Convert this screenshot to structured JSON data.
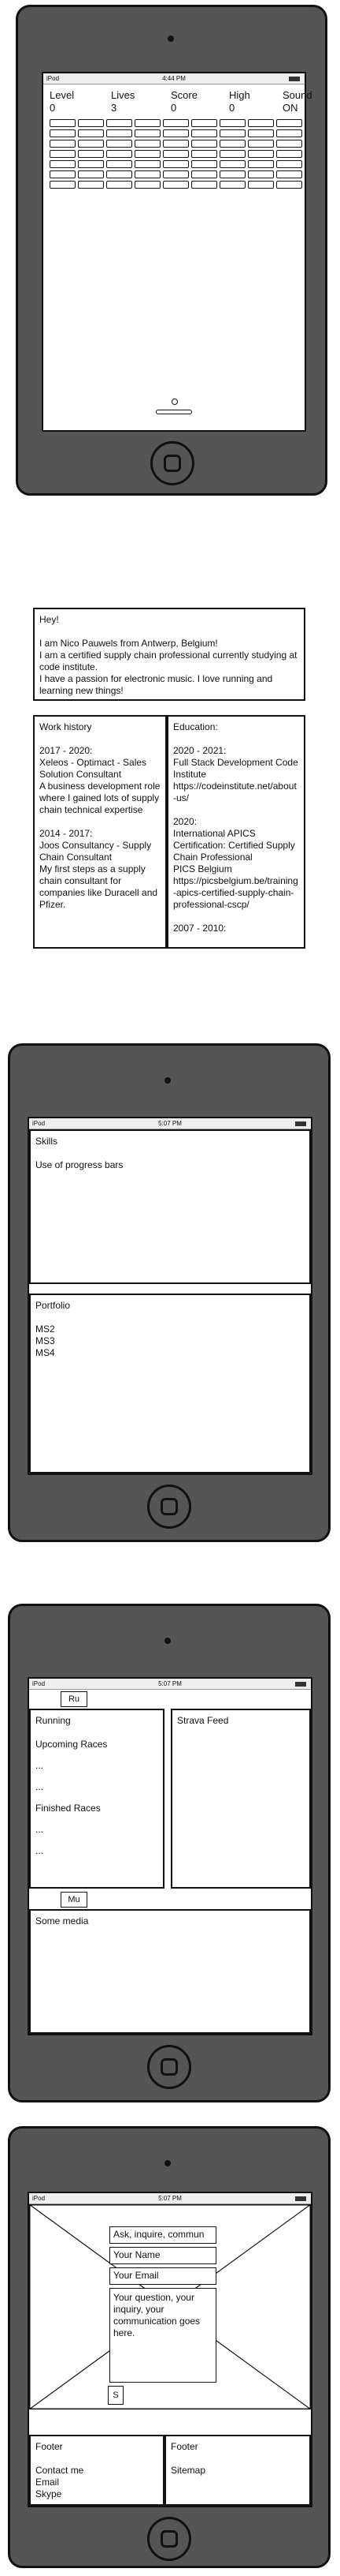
{
  "game_screen": {
    "status": {
      "carrier": "iPod",
      "time": "4:44 PM"
    },
    "stats": [
      {
        "label": "Level",
        "value": "0"
      },
      {
        "label": "Lives",
        "value": "3"
      },
      {
        "label": "Score",
        "value": "0"
      },
      {
        "label": "High",
        "value": "0"
      },
      {
        "label": "Sound",
        "value": "ON"
      }
    ]
  },
  "about": {
    "intro": [
      "Hey!",
      "",
      "I am Nico Pauwels from Antwerp, Belgium!",
      "I am a certified supply chain professional currently studying at code institute.",
      "I have a passion for electronic music. I love running and learning new things!"
    ],
    "work_history": {
      "title": "Work history",
      "lines": [
        "2017 - 2020:",
        "Xeleos - Optimact - Sales Solution Consultant",
        "A business development role where I gained lots of supply chain technical expertise",
        "",
        "2014 - 2017:",
        "Joos Consultancy - Supply Chain Consultant",
        "My first steps as a supply chain consultant for companies like Duracell and Pfizer."
      ]
    },
    "education": {
      "title": "Education:",
      "lines": [
        "2020 - 2021:",
        "Full Stack Development Code Institute",
        "https://codeinstitute.net/about-us/",
        "",
        "2020:",
        "International APICS Certification: Certified Supply Chain Professional",
        "PICS Belgium",
        "https://picsbelgium.be/training-apics-certified-supply-chain-professional-cscp/",
        "",
        "2007 - 2010:"
      ]
    }
  },
  "skills_screen": {
    "status": {
      "carrier": "iPod",
      "time": "5:07 PM"
    },
    "skills": {
      "title": "Skills",
      "text": "Use of progress bars"
    },
    "portfolio": {
      "title": "Portfolio",
      "items": [
        "MS2",
        "MS3",
        "MS4"
      ]
    }
  },
  "running_screen": {
    "status": {
      "carrier": "iPod",
      "time": "5:07 PM"
    },
    "tab_ru": "Ru",
    "running": {
      "title": "Running",
      "upcoming": "Upcoming Races",
      "upcoming_items": [
        "...",
        "..."
      ],
      "finished": "Finished Races",
      "finished_items": [
        "...",
        "..."
      ]
    },
    "strava": {
      "title": "Strava Feed"
    },
    "tab_mu": "Mu",
    "media": {
      "title": "Some media"
    }
  },
  "contact_screen": {
    "status": {
      "carrier": "iPod",
      "time": "5:07 PM"
    },
    "form": {
      "subject": "Ask, inquire, commun",
      "name": "Your Name",
      "email": "Your Email",
      "message": "Your question, your inquiry, your communication goes here.",
      "submit": "S"
    },
    "footer_left": {
      "title": "Footer",
      "lines": [
        "Contact me",
        "Email",
        "Skype"
      ]
    },
    "footer_right": {
      "title": "Footer",
      "lines": [
        "Sitemap"
      ]
    }
  }
}
